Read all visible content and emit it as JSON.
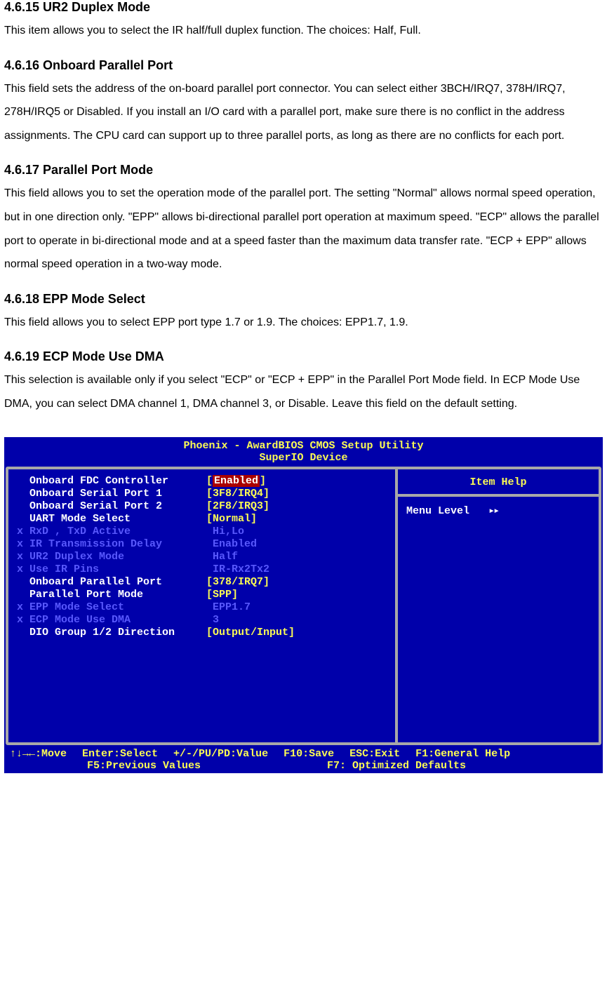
{
  "sections": [
    {
      "heading": "4.6.15 UR2 Duplex Mode",
      "body": "This item allows you to select the IR half/full duplex function. The choices: Half, Full."
    },
    {
      "heading": "4.6.16 Onboard Parallel Port",
      "body": "This field sets the address of the on-board parallel port connector. You can select either 3BCH/IRQ7, 378H/IRQ7, 278H/IRQ5 or Disabled. If you install an I/O card with a parallel port, make sure there is no conflict in the address assignments. The CPU card can support up to three parallel ports, as long as there are no conflicts for each port."
    },
    {
      "heading": "4.6.17 Parallel Port Mode",
      "body": "This field allows you to set the operation mode of the parallel port. The setting \"Normal\" allows normal speed operation, but in one direction only. \"EPP\" allows bi-directional parallel port operation at maximum speed. \"ECP\" allows the parallel port to operate in bi-directional mode and at a speed faster than the maximum data transfer rate. \"ECP + EPP\" allows normal speed operation in a two-way mode."
    },
    {
      "heading": "4.6.18 EPP Mode Select",
      "body": "This field allows you to select EPP port type 1.7 or 1.9. The choices: EPP1.7, 1.9."
    },
    {
      "heading": "4.6.19 ECP Mode Use DMA",
      "body": "This selection is available only if you select \"ECP\" or \"ECP + EPP\" in the Parallel Port Mode field. In ECP Mode Use DMA, you can select DMA channel 1, DMA channel 3, or Disable. Leave this field on the default setting."
    }
  ],
  "bios": {
    "title": "Phoenix - AwardBIOS CMOS Setup Utility",
    "subtitle": "SuperIO Device",
    "help_header": "Item Help",
    "menu_level_label": "Menu Level",
    "menu_level_arrows": "▸▸",
    "settings": [
      {
        "label": "Onboard FDC Controller",
        "value": "Enabled",
        "disabled": false,
        "selected": true,
        "bracketed": true
      },
      {
        "label": "Onboard Serial Port 1",
        "value": "3F8/IRQ4",
        "disabled": false,
        "selected": false,
        "bracketed": true
      },
      {
        "label": "Onboard Serial Port 2",
        "value": "2F8/IRQ3",
        "disabled": false,
        "selected": false,
        "bracketed": true
      },
      {
        "label": "UART Mode Select",
        "value": "Normal",
        "disabled": false,
        "selected": false,
        "bracketed": true
      },
      {
        "label": "RxD , TxD Active",
        "value": "Hi,Lo",
        "disabled": true,
        "selected": false,
        "bracketed": false
      },
      {
        "label": "IR Transmission Delay",
        "value": "Enabled",
        "disabled": true,
        "selected": false,
        "bracketed": false
      },
      {
        "label": "UR2 Duplex Mode",
        "value": "Half",
        "disabled": true,
        "selected": false,
        "bracketed": false
      },
      {
        "label": "Use IR Pins",
        "value": "IR-Rx2Tx2",
        "disabled": true,
        "selected": false,
        "bracketed": false
      },
      {
        "label": "Onboard Parallel Port",
        "value": "378/IRQ7",
        "disabled": false,
        "selected": false,
        "bracketed": true
      },
      {
        "label": "Parallel Port Mode",
        "value": "SPP",
        "disabled": false,
        "selected": false,
        "bracketed": true
      },
      {
        "label": "EPP Mode Select",
        "value": "EPP1.7",
        "disabled": true,
        "selected": false,
        "bracketed": false
      },
      {
        "label": "ECP Mode Use DMA",
        "value": "3",
        "disabled": true,
        "selected": false,
        "bracketed": false
      },
      {
        "label": "DIO Group 1/2 Direction",
        "value": "Output/Input",
        "disabled": false,
        "selected": false,
        "bracketed": true
      }
    ],
    "footer": {
      "move": "↑↓→←:Move",
      "select": "Enter:Select",
      "value": "+/-/PU/PD:Value",
      "save": "F10:Save",
      "exit": "ESC:Exit",
      "help": "F1:General Help",
      "prev": "F5:Previous Values",
      "opt": "F7: Optimized Defaults"
    }
  }
}
